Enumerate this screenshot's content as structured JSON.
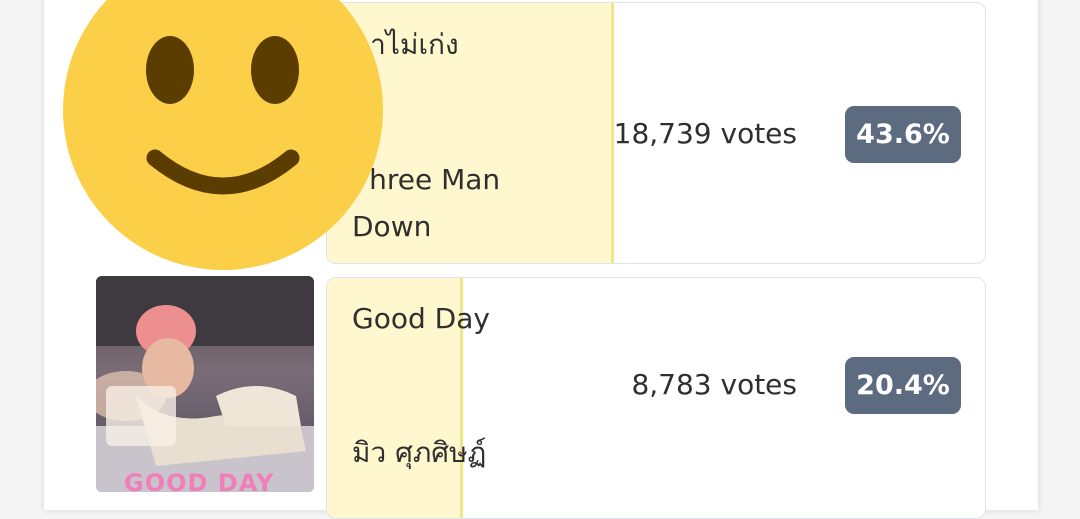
{
  "results": [
    {
      "song": "ดาไม่เก่ง",
      "artist": "Three Man Down",
      "votes": "18,739 votes",
      "percent": "43.6%",
      "share": 0.436
    },
    {
      "song": "Good Day",
      "artist": "มิว ศุภศิษฏ์",
      "votes": "8,783 votes",
      "percent": "20.4%",
      "share": 0.204,
      "cover_text": "GOOD DAY"
    }
  ],
  "colors": {
    "bar_fill": "#fff8cf",
    "badge": "#5c6b80",
    "emoji": "#fbcf47"
  },
  "overlay": {
    "icon": "smiley-face-emoji-icon"
  }
}
